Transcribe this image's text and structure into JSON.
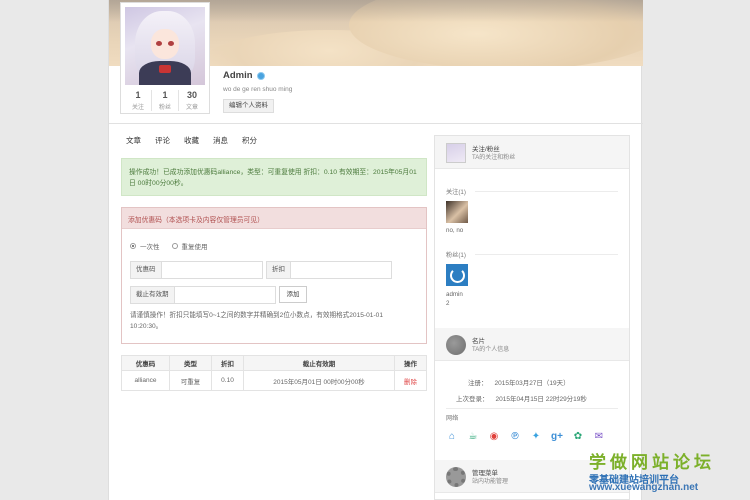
{
  "profile": {
    "name": "Admin",
    "description": "wo de ge ren shuo ming",
    "edit_label": "编辑个人资料",
    "stats": [
      {
        "num": "1",
        "label": "关注"
      },
      {
        "num": "1",
        "label": "粉丝"
      },
      {
        "num": "30",
        "label": "文章"
      }
    ]
  },
  "tabs": [
    "文章",
    "评论",
    "收藏",
    "消息",
    "积分"
  ],
  "alert": {
    "text": "操作成功！已成功添加优惠码alliance，类型：可重复使用 折扣：0.10 有效期至：2015年05月01日 00时00分00秒。"
  },
  "coupon_form": {
    "title": "添加优惠码（本选项卡及内容仅管理员可见）",
    "radio_once": "一次性",
    "radio_repeat": "重复使用",
    "code_label": "优惠码",
    "discount_label": "折扣",
    "expiry_label": "截止有效期",
    "add_label": "添加",
    "hint": "请谨慎操作！折扣只能填写0~1之间的数字并精确到2位小数点，有效期格式2015-01-01 10:20:30。"
  },
  "coupon_table": {
    "headers": [
      "优惠码",
      "类型",
      "折扣",
      "截止有效期",
      "操作"
    ],
    "rows": [
      {
        "code": "alliance",
        "type": "可重复",
        "discount": "0.10",
        "expiry": "2015年05月01日 00时00分00秒",
        "action": "删除"
      }
    ]
  },
  "sidebar": {
    "follow": {
      "title": "关注/粉丝",
      "subtitle": "TA的关注和粉丝"
    },
    "following_label": "关注(1)",
    "following_user": "no, no",
    "fans_label": "粉丝(1)",
    "fans_user": "admin",
    "fans_user_count": "2",
    "card": {
      "title": "名片",
      "subtitle": "TA的个人信息"
    },
    "register_label": "注册：",
    "register_value": "2015年03月27日（19天）",
    "last_login_label": "上次登录：",
    "last_login_value": "2015年04月15日 22时29分19秒",
    "network_label": "网络",
    "admin": {
      "title": "管理菜单",
      "subtitle": "站内功能管理"
    }
  },
  "watermark": {
    "line1": "学做网站论坛",
    "line2": "零基础建站培训平台",
    "url": "www.xuewangzhan.net"
  },
  "social_icons": [
    {
      "name": "home-icon",
      "glyph": "⌂",
      "color": "#3d8fd6"
    },
    {
      "name": "cup-icon",
      "glyph": "☕",
      "color": "#2aa676"
    },
    {
      "name": "weibo-icon",
      "glyph": "◉",
      "color": "#e0403a"
    },
    {
      "name": "pinterest-icon",
      "glyph": "℗",
      "color": "#3d8fd6"
    },
    {
      "name": "twitter-icon",
      "glyph": "✦",
      "color": "#3aa3e0"
    },
    {
      "name": "google-plus-icon",
      "glyph": "g+",
      "color": "#3d8fd6"
    },
    {
      "name": "wechat-icon",
      "glyph": "✿",
      "color": "#2aa676"
    },
    {
      "name": "mail-icon",
      "glyph": "✉",
      "color": "#7a52c7"
    }
  ]
}
